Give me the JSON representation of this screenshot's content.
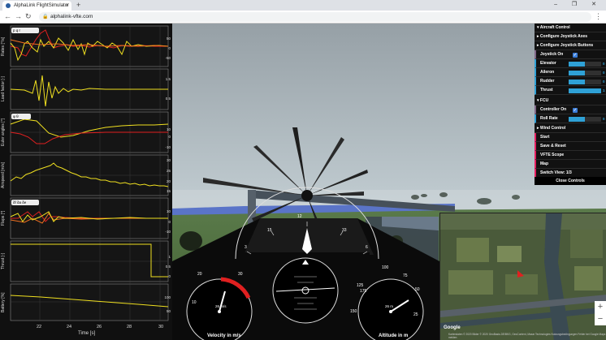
{
  "browser": {
    "tab_title": "AlphaLink FlightSimulator",
    "tab_close": "×",
    "new_tab": "+",
    "url": "alphalink-vfte.com",
    "window_controls": "–  ❐  ✕"
  },
  "plots": {
    "panels": [
      {
        "ylabel": "Rates [°/s]",
        "ticks": [
          "50",
          "0",
          "-50"
        ],
        "legend": "p  q  r"
      },
      {
        "ylabel": "Load factor [-]",
        "ticks": [
          "1.5",
          "0.5"
        ]
      },
      {
        "ylabel": "Euler angles [°]",
        "ticks": [
          "10",
          "0",
          "-10"
        ],
        "legend": "φ  θ"
      },
      {
        "ylabel": "Airspeed [m/s]",
        "ticks": [
          "30",
          "25",
          "20",
          "15"
        ]
      },
      {
        "ylabel": "Flaps [°]",
        "ticks": [
          "10",
          "0",
          "-10"
        ],
        "legend": "δf  δa  δe"
      },
      {
        "ylabel": "Thrust [-]",
        "ticks": [
          "1",
          "0.5",
          "0"
        ]
      },
      {
        "ylabel": "Battery [%]",
        "ticks": [
          "100",
          "50"
        ]
      }
    ],
    "x_ticks": [
      "22",
      "24",
      "26",
      "28",
      "30"
    ],
    "xlabel": "Time [s]"
  },
  "control_panel": {
    "aircraft_control": "Aircraft Control",
    "configure_axes": "Configure Joystick Axes",
    "configure_buttons": "Configure Joystick Buttons",
    "joystick_on": "Joystick On",
    "elevator": "Elevator",
    "aileron": "Aileron",
    "rudder": "Rudder",
    "thrust": "Thrust",
    "slider_values": [
      "0",
      "0",
      "0",
      "1"
    ],
    "slider_levels": [
      0.5,
      0.5,
      0.5,
      1.0
    ],
    "fcu": "FCU",
    "controller_on": "Controller On",
    "roll_rate": "Roll Rate",
    "roll_rate_value": "0",
    "wind_control": "Wind Control",
    "start": "Start",
    "save_reset": "Save & Reset",
    "vfte_scope": "VFTE Scope",
    "map": "Map",
    "switch_view": "Switch View",
    "switch_view_value": "1/3",
    "close_controls": "Close Controls",
    "check_mark": "✓"
  },
  "instruments": {
    "velocity_label": "Velocity in m/s",
    "altitude_label": "Altitude in m",
    "velocity_readout": "26 m/s",
    "altitude_readout": "26 m",
    "velocity_ticks": [
      "20",
      "30",
      "10"
    ],
    "altitude_ticks": [
      "150",
      "100",
      "125",
      "175",
      "50",
      "75",
      "25"
    ],
    "heading_ticks": [
      "15",
      "33",
      "6",
      "W",
      "3",
      "E",
      "12"
    ]
  },
  "map": {
    "google_logo": "Google",
    "copyright": "Kartendaten © 2020 Bilder © 2020 GeoBasis-DE/BKG, GeoContent, Maxar Technologies   Nutzungsbedingungen   Fehler bei Google Maps melden",
    "zoom_in": "+",
    "zoom_out": "−"
  },
  "colors": {
    "accent_green": "#1ed36f",
    "accent_pink": "#e61d5f",
    "accent_blue": "#2fa1d6",
    "plot_yellow": "#f0e020",
    "plot_red": "#e02020"
  }
}
